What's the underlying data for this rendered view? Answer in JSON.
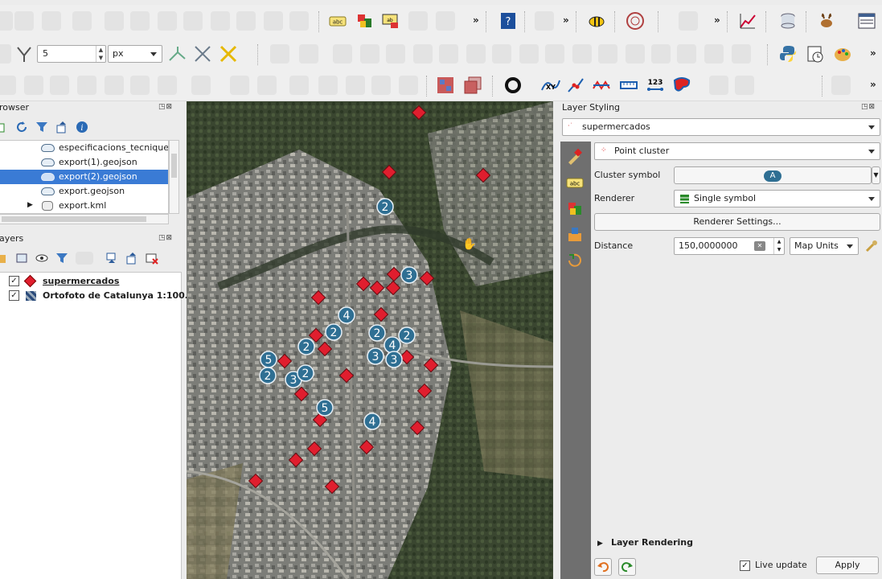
{
  "toolbar2": {
    "size_value": "5",
    "size_unit": "px"
  },
  "browser": {
    "title": "rowser",
    "items": [
      {
        "label": "especificacions_tecnique"
      },
      {
        "label": "export(1).geojson"
      },
      {
        "label": "export(2).geojson"
      },
      {
        "label": "export.geojson"
      },
      {
        "label": "export.kml"
      }
    ]
  },
  "layers": {
    "title": "ayers",
    "items": [
      {
        "label": "supermercados",
        "checked": true
      },
      {
        "label": "Ortofoto de Catalunya 1:100...",
        "checked": true
      }
    ]
  },
  "map": {
    "cluster_labels": [
      "2",
      "3",
      "4",
      "2",
      "2",
      "2",
      "4",
      "2",
      "3",
      "3",
      "5",
      "2",
      "3",
      "2",
      "5",
      "4"
    ]
  },
  "styling": {
    "title": "Layer Styling",
    "layer_select": "supermercados",
    "renderer_type": "Point cluster",
    "cluster_symbol_label": "Cluster symbol",
    "renderer_label": "Renderer",
    "renderer_value": "Single symbol",
    "renderer_settings_button": "Renderer Settings...",
    "distance_label": "Distance",
    "distance_value": "150,0000000",
    "distance_unit": "Map Units",
    "layer_rendering_label": "Layer Rendering",
    "live_update_label": "Live update",
    "apply_button": "Apply"
  },
  "colors": {
    "selection": "#3a7bd5",
    "marker_red": "#e01e2e",
    "cluster_blue": "#2f6f93",
    "sidebar": "#6f6f6f"
  }
}
